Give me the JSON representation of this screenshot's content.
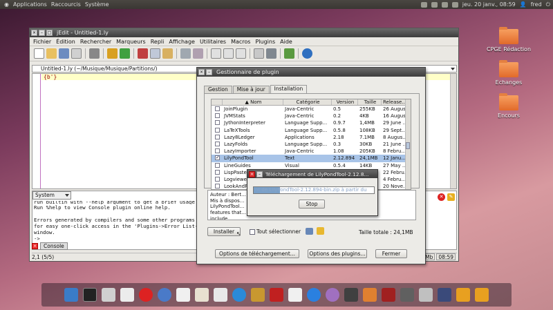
{
  "topbar": {
    "applications": "Applications",
    "places": "Raccourcis",
    "system": "Système",
    "datetime": "jeu. 20 janv., 08:59",
    "user": "fred"
  },
  "desktop": {
    "icons": [
      {
        "label": "CPGE Rédaction"
      },
      {
        "label": "Echanges"
      },
      {
        "label": "Encours"
      }
    ]
  },
  "jedit": {
    "title": "jEdit - Untitled-1.ly",
    "menu": [
      "Fichier",
      "Édition",
      "Rechercher",
      "Marqueurs",
      "Repli",
      "Affichage",
      "Utilitaires",
      "Macros",
      "Plugins",
      "Aide"
    ],
    "path": "Untitled-1.ly (~/Musique/Musique/Partitions/)",
    "code": "{b'}",
    "console_combo": "System",
    "console_lines": [
      "Run %help to view Console plugin online help.",
      "",
      "Errors generated by compilers and some other programs are",
      "for easy one-click access in the 'Plugins->Error List->Err",
      "window.",
      "->"
    ],
    "console_partial": "run builtin with --help argument to get a brief usage mes",
    "console_tab": "Console",
    "status_left": "2,1 (5/5)",
    "status_mem": "91Mb",
    "status_time": "08:59"
  },
  "plugin_manager": {
    "title": "Gestionnaire de plugin",
    "tabs": [
      "Gestion",
      "Mise à jour",
      "Installation"
    ],
    "columns": [
      "Nom",
      "Catégorie",
      "Version",
      "Taille",
      "Release..."
    ],
    "rows": [
      {
        "checked": false,
        "name": "JoinPlugin",
        "category": "Java-Centric",
        "version": "0.5",
        "size": "255KB",
        "release": "26 Augus..."
      },
      {
        "checked": false,
        "name": "JVMStats",
        "category": "Java-Centric",
        "version": "0.2",
        "size": "4KB",
        "release": "16 Augus..."
      },
      {
        "checked": false,
        "name": "JythonInterpreter",
        "category": "Language Supp...",
        "version": "0.9.7",
        "size": "1,4MB",
        "release": "29 June ..."
      },
      {
        "checked": false,
        "name": "LaTeXTools",
        "category": "Language Supp...",
        "version": "0.5.8",
        "size": "108KB",
        "release": "29 Sept..."
      },
      {
        "checked": false,
        "name": "Lazy8Ledger",
        "category": "Applications",
        "version": "2.18",
        "size": "7.1MB",
        "release": "8 Augus..."
      },
      {
        "checked": false,
        "name": "LazyFolds",
        "category": "Language Supp...",
        "version": "0.3",
        "size": "30KB",
        "release": "21 June ..."
      },
      {
        "checked": false,
        "name": "LazyImporter",
        "category": "Java-Centric",
        "version": "1.08",
        "size": "205KB",
        "release": "8 Febru..."
      },
      {
        "checked": true,
        "name": "LilyPondTool",
        "category": "Text",
        "version": "2.12.894",
        "size": "24,1MB",
        "release": "12 Janu..."
      },
      {
        "checked": false,
        "name": "LineGuides",
        "category": "Visual",
        "version": "0.5.4",
        "size": "14KB",
        "release": "27 May ..."
      },
      {
        "checked": false,
        "name": "LispPaste",
        "category": "",
        "version": "",
        "size": "",
        "release": "22 Febru..."
      },
      {
        "checked": false,
        "name": "Logviewer",
        "category": "",
        "version": "",
        "size": "",
        "release": "4 Febru..."
      },
      {
        "checked": false,
        "name": "LookAndFeel",
        "category": "",
        "version": "",
        "size": "",
        "release": "20 Nove..."
      }
    ],
    "description": "Auteur : Bert...\nMis à dispos...\nLilyPondTool...\nfeatures that...\ninclude",
    "install": "Installer",
    "select_all": "Tout sélectionner",
    "total_size": "Taille totale : 24,1MB",
    "download_options": "Options de téléchargement...",
    "plugin_options": "Options des plugins...",
    "close": "Fermer"
  },
  "download": {
    "title": "Téléchargement de LilyPondTool-2.12.8...",
    "progress_text": "nt de LilyPondTool-2.12.894-bin.zip à partir du",
    "progress_percent": 22,
    "stop": "Stop"
  }
}
